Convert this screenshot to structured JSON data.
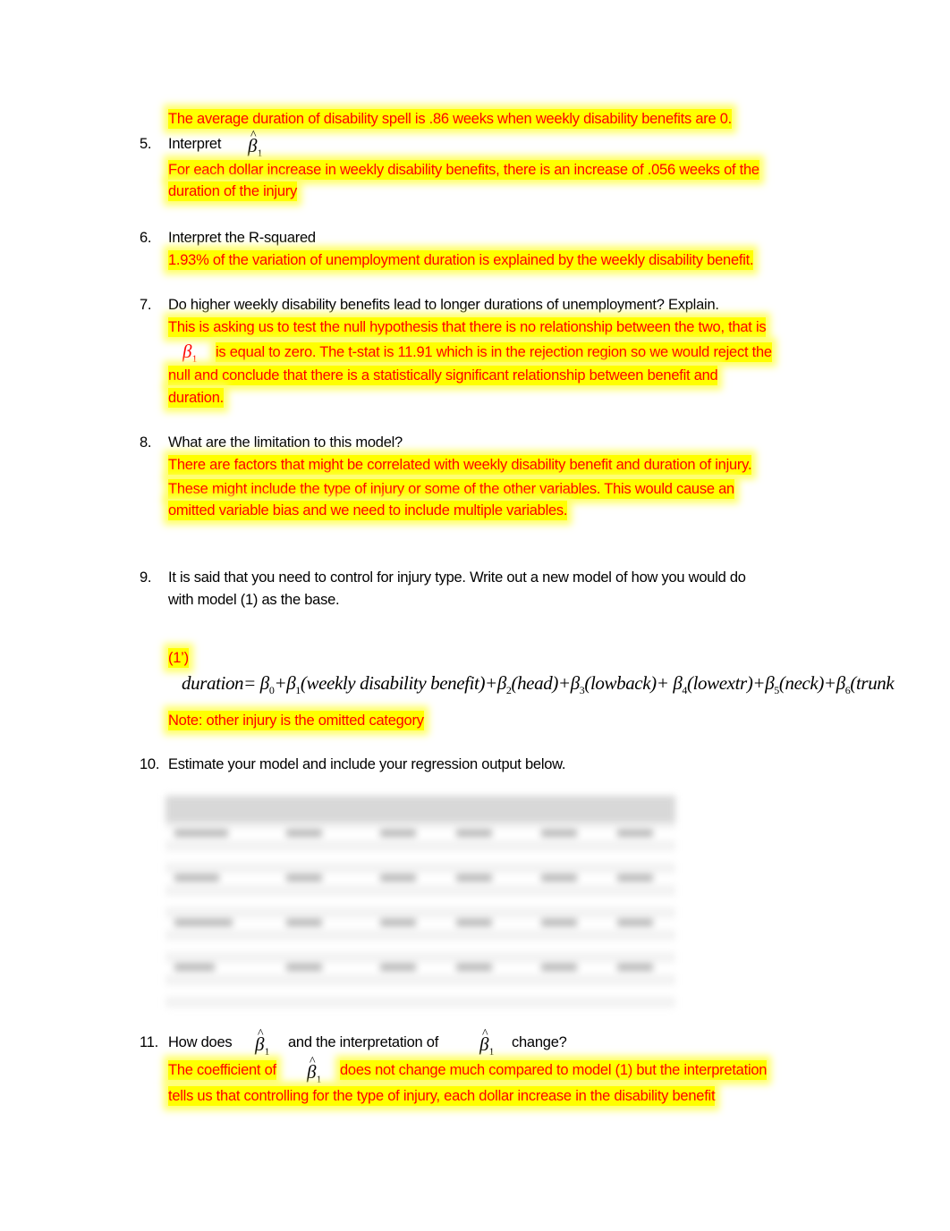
{
  "answers": {
    "a4": "The average duration of disability spell is .86 weeks when weekly disability benefits are 0.",
    "a5": [
      "For each dollar increase in weekly disability benefits, there is an increase of .056 weeks of the",
      "duration of the injury"
    ],
    "a6": "1.93% of the variation of unemployment duration is explained by the weekly disability benefit.",
    "a7": [
      "This is asking us to test the null hypothesis that there is no relationship between the two, that is",
      "is equal to zero. The t-stat is 11.91 which is in the rejection region so we would reject the",
      "null and conclude that there is a statistically significant relationship between benefit and",
      "duration."
    ],
    "a8": [
      "There are factors that might be correlated with weekly disability benefit and duration of injury.",
      "These might include the type of injury or some of the other variables. This would cause an",
      "omitted variable bias and we need to include multiple variables."
    ],
    "model_label": "(1’)",
    "note": "Note: other injury is the omitted category",
    "a11_pre": "The coefficient of",
    "a11": [
      "does not change much compared to model (1) but the interpretation",
      "tells us that controlling for the type of injury, each dollar increase in the disability benefit"
    ]
  },
  "questions": {
    "q5": {
      "num": "5.",
      "text": "Interpret"
    },
    "q6": {
      "num": "6.",
      "text": "Interpret the R-squared"
    },
    "q7": {
      "num": "7.",
      "text": "Do higher weekly disability benefits lead to longer durations of unemployment? Explain."
    },
    "q8": {
      "num": "8.",
      "text": "What are the limitation to this model?"
    },
    "q9": {
      "num": "9.",
      "text": [
        "It is said that you need to control for injury type. Write out a new model of how you would do",
        "with model (1) as the base."
      ]
    },
    "q10": {
      "num": "10.",
      "text": "Estimate your model and include your regression output below."
    },
    "q11": {
      "num": "11.",
      "a": "How does",
      "b": "and the interpretation of",
      "c": "change?"
    }
  },
  "equation": {
    "lhs": "duration",
    "terms": [
      "weekly disability benefit",
      "head",
      "lowback",
      "lowextr",
      "neck",
      "trunk"
    ]
  },
  "symbols": {
    "beta": "β",
    "hat": "^",
    "sub1": "1"
  }
}
